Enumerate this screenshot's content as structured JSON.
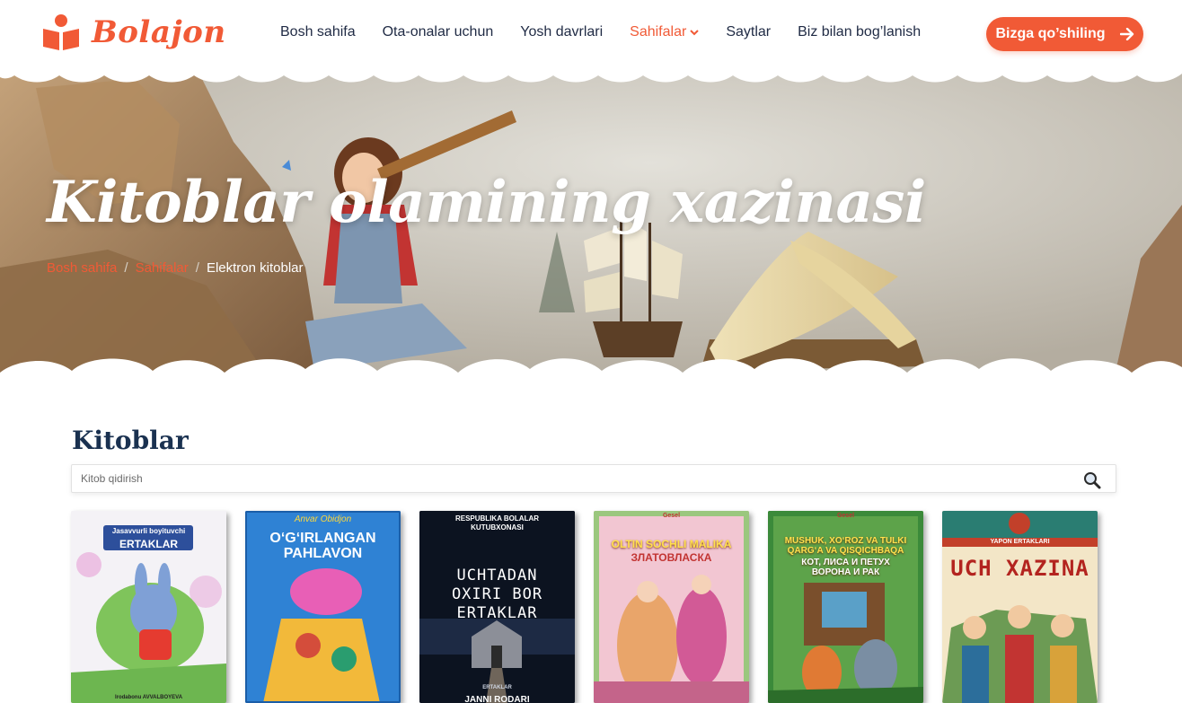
{
  "brand": {
    "name": "Bolajon"
  },
  "nav": {
    "items": [
      "Bosh sahifa",
      "Ota-onalar uchun",
      "Yosh davrlari",
      "Sahifalar",
      "Saytlar",
      "Biz bilan bog’lanish"
    ],
    "active": "Sahifalar"
  },
  "cta": {
    "label": "Bizga qo’shiling"
  },
  "hero": {
    "title": "Kitoblar olamining xazinasi",
    "breadcrumb": [
      "Bosh sahifa",
      "Sahifalar",
      "Elektron kitoblar"
    ]
  },
  "main": {
    "title": "Kitoblar",
    "search": {
      "placeholder": "Kitob qidirish",
      "value": ""
    },
    "books": [
      {
        "author": "Jasavvurli boyituvchi",
        "title": "ERTAKLAR",
        "footer": "Irodabonu AVVALBOYEVA",
        "color": "#f4f6f8"
      },
      {
        "author": "Anvar Obidjon",
        "title": "O‘G‘IRLANGAN PAHLAVON",
        "color": "#2d7fd3"
      },
      {
        "author": "RESPUBLIKA BOLALAR KUTUBXONASI",
        "title": "UCHTADAN OXIRI BOR ERTAKLAR",
        "footer": "ERTAKLAR",
        "footer2": "JANNI RODARI",
        "color": "#0f1726"
      },
      {
        "author": "Gesel",
        "title": "OLTIN SOCHLI MALIKA",
        "subtitle": "ЗЛАТОВЛАСКА",
        "color": "#efb9c9"
      },
      {
        "author": "Gesel",
        "title": "MUSHUK, XO‘ROZ VA TULKI QARG‘A VA QISQICHBAQA",
        "subtitle": "КОТ, ЛИСА И ПЕТУХ ВОРОНА И РАК",
        "color": "#3f8e3b"
      },
      {
        "author": "YAPON ERTAKLARI",
        "title": "UCH XAZINA",
        "color": "#f2e3c4"
      }
    ]
  },
  "colors": {
    "accent": "#f15a36",
    "heading": "#1a3150",
    "text": "#1f2a44"
  }
}
